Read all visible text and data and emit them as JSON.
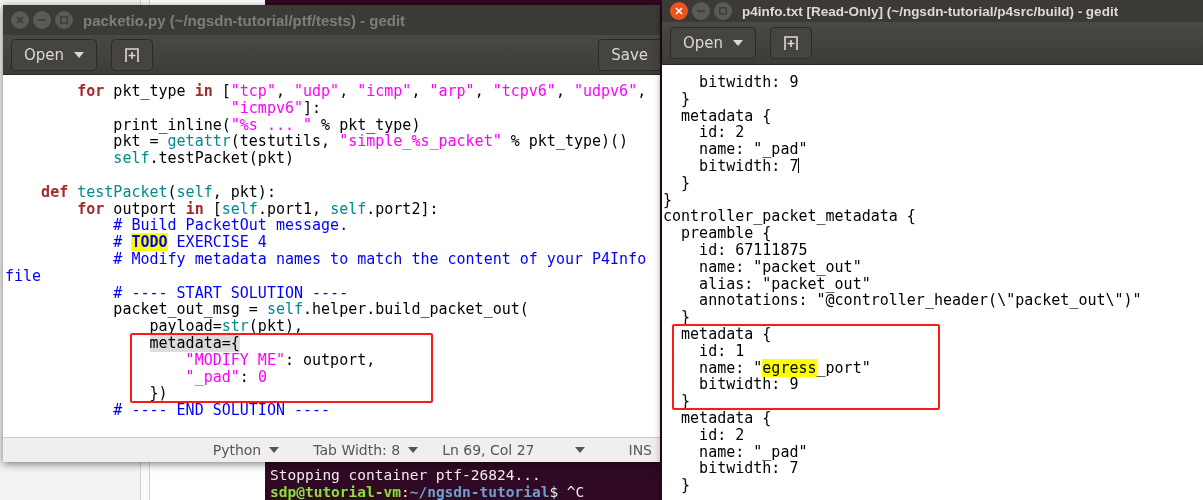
{
  "terminal": {
    "lines": [
      {
        "tokens": [
          {
            "kind": "plain",
            "text": "Stopping container ptf-26824..."
          }
        ]
      },
      {
        "tokens": [
          {
            "kind": "user",
            "text": "sdp@tutorial-vm"
          },
          {
            "kind": "plain",
            "text": ":"
          },
          {
            "kind": "path",
            "text": "~/ngsdn-tutorial"
          },
          {
            "kind": "plain",
            "text": "$ ^C"
          }
        ]
      }
    ]
  },
  "windows": [
    {
      "title": "packetio.py (~/ngsdn-tutorial/ptf/tests) - gedit",
      "focused": false,
      "toolbar": {
        "open_label": "Open",
        "save_label": "Save"
      },
      "editor": {
        "lines": [
          {
            "tokens": [
              {
                "kind": "keyword",
                "text": "        for"
              },
              {
                "kind": "plain",
                "text": " pkt_type "
              },
              {
                "kind": "keyword",
                "text": "in"
              },
              {
                "kind": "plain",
                "text": " ["
              },
              {
                "kind": "string",
                "text": "\"tcp\""
              },
              {
                "kind": "plain",
                "text": ", "
              },
              {
                "kind": "string",
                "text": "\"udp\""
              },
              {
                "kind": "plain",
                "text": ", "
              },
              {
                "kind": "string",
                "text": "\"icmp\""
              },
              {
                "kind": "plain",
                "text": ", "
              },
              {
                "kind": "string",
                "text": "\"arp\""
              },
              {
                "kind": "plain",
                "text": ", "
              },
              {
                "kind": "string",
                "text": "\"tcpv6\""
              },
              {
                "kind": "plain",
                "text": ", "
              },
              {
                "kind": "string",
                "text": "\"udpv6\""
              },
              {
                "kind": "plain",
                "text": ","
              }
            ]
          },
          {
            "tokens": [
              {
                "kind": "string",
                "text": "                         \"icmpv6\""
              },
              {
                "kind": "plain",
                "text": "]:"
              }
            ]
          },
          {
            "tokens": [
              {
                "kind": "plain",
                "text": "            print_inline("
              },
              {
                "kind": "string",
                "text": "\"%s ... \""
              },
              {
                "kind": "plain",
                "text": " % pkt_type)"
              }
            ]
          },
          {
            "tokens": [
              {
                "kind": "plain",
                "text": "            pkt = "
              },
              {
                "kind": "builtin",
                "text": "getattr"
              },
              {
                "kind": "plain",
                "text": "(testutils, "
              },
              {
                "kind": "string",
                "text": "\"simple_%s_packet\""
              },
              {
                "kind": "plain",
                "text": " % pkt_type)()"
              }
            ]
          },
          {
            "tokens": [
              {
                "kind": "builtin",
                "text": "            self"
              },
              {
                "kind": "plain",
                "text": ".testPacket(pkt)"
              }
            ]
          },
          {
            "kind": "blank"
          },
          {
            "tokens": [
              {
                "kind": "keyword",
                "text": "    def"
              },
              {
                "kind": "builtin",
                "text": " testPacket"
              },
              {
                "kind": "plain",
                "text": "("
              },
              {
                "kind": "builtin",
                "text": "self"
              },
              {
                "kind": "plain",
                "text": ", pkt):"
              }
            ]
          },
          {
            "tokens": [
              {
                "kind": "keyword",
                "text": "        for"
              },
              {
                "kind": "plain",
                "text": " outport "
              },
              {
                "kind": "keyword",
                "text": "in"
              },
              {
                "kind": "plain",
                "text": " ["
              },
              {
                "kind": "builtin",
                "text": "self"
              },
              {
                "kind": "plain",
                "text": ".port1, "
              },
              {
                "kind": "builtin",
                "text": "self"
              },
              {
                "kind": "plain",
                "text": ".port2]:"
              }
            ]
          },
          {
            "tokens": [
              {
                "kind": "comment",
                "text": "            # Build PacketOut message."
              }
            ]
          },
          {
            "tokens": [
              {
                "kind": "comment",
                "text": "            # "
              },
              {
                "kind": "todo",
                "text": "TODO"
              },
              {
                "kind": "comment",
                "text": " EXERCISE 4"
              }
            ]
          },
          {
            "tokens": [
              {
                "kind": "comment",
                "text": "            # Modify metadata names to match the content of your P4Info"
              }
            ]
          },
          {
            "tokens": [
              {
                "kind": "comment",
                "text": "file"
              }
            ]
          },
          {
            "tokens": [
              {
                "kind": "comment",
                "text": "            # ---- START SOLUTION ----"
              }
            ]
          },
          {
            "tokens": [
              {
                "kind": "plain",
                "text": "            packet_out_msg = "
              },
              {
                "kind": "builtin",
                "text": "self"
              },
              {
                "kind": "plain",
                "text": ".helper.build_packet_out("
              }
            ]
          },
          {
            "tokens": [
              {
                "kind": "plain",
                "text": "                payload="
              },
              {
                "kind": "builtin",
                "text": "str"
              },
              {
                "kind": "plain",
                "text": "(pkt),"
              }
            ]
          },
          {
            "tokens": [
              {
                "kind": "match",
                "text": "                metadata={"
              }
            ]
          },
          {
            "tokens": [
              {
                "kind": "string",
                "text": "                    \"MODIFY ME\""
              },
              {
                "kind": "plain",
                "text": ": outport,"
              }
            ]
          },
          {
            "tokens": [
              {
                "kind": "string",
                "text": "                    \"_pad\""
              },
              {
                "kind": "plain",
                "text": ": "
              },
              {
                "kind": "number",
                "text": "0"
              }
            ]
          },
          {
            "tokens": [
              {
                "kind": "plain",
                "text": "                })"
              }
            ]
          },
          {
            "tokens": [
              {
                "kind": "comment",
                "text": "            # ---- END SOLUTION ----"
              }
            ]
          }
        ]
      },
      "status_bar": {
        "language": "Python",
        "tab_width": "Tab Width: 8",
        "position": "Ln 69, Col 27",
        "mode": "INS"
      }
    },
    {
      "title": "p4info.txt [Read-Only] (~/ngsdn-tutorial/p4src/build) - gedit",
      "focused": true,
      "toolbar": {
        "open_label": "Open"
      },
      "editor": {
        "lines": [
          {
            "tokens": [
              {
                "kind": "plain",
                "text": "    bitwidth: 9"
              }
            ]
          },
          {
            "tokens": [
              {
                "kind": "plain",
                "text": "  }"
              }
            ]
          },
          {
            "tokens": [
              {
                "kind": "plain",
                "text": "  metadata {"
              }
            ]
          },
          {
            "tokens": [
              {
                "kind": "plain",
                "text": "    id: 2"
              }
            ]
          },
          {
            "tokens": [
              {
                "kind": "plain",
                "text": "    name: \"_pad\""
              }
            ]
          },
          {
            "tokens": [
              {
                "kind": "plain",
                "text": "    bitwidth: 7"
              },
              {
                "kind": "cursor"
              }
            ]
          },
          {
            "tokens": [
              {
                "kind": "plain",
                "text": "  }"
              }
            ]
          },
          {
            "tokens": [
              {
                "kind": "plain",
                "text": "}"
              }
            ]
          },
          {
            "tokens": [
              {
                "kind": "plain",
                "text": "controller_packet_metadata {"
              }
            ]
          },
          {
            "tokens": [
              {
                "kind": "plain",
                "text": "  preamble {"
              }
            ]
          },
          {
            "tokens": [
              {
                "kind": "plain",
                "text": "    id: 67111875"
              }
            ]
          },
          {
            "tokens": [
              {
                "kind": "plain",
                "text": "    name: \"packet_out\""
              }
            ]
          },
          {
            "tokens": [
              {
                "kind": "plain",
                "text": "    alias: \"packet_out\""
              }
            ]
          },
          {
            "tokens": [
              {
                "kind": "plain",
                "text": "    annotations: \"@controller_header(\\\"packet_out\\\")\""
              }
            ]
          },
          {
            "tokens": [
              {
                "kind": "plain",
                "text": "  }"
              }
            ]
          },
          {
            "tokens": [
              {
                "kind": "plain",
                "text": "  metadata {"
              }
            ]
          },
          {
            "tokens": [
              {
                "kind": "plain",
                "text": "    id: 1"
              }
            ]
          },
          {
            "tokens": [
              {
                "kind": "plain",
                "text": "    name: \""
              },
              {
                "kind": "search",
                "text": "egress"
              },
              {
                "kind": "plain",
                "text": "_port\""
              }
            ]
          },
          {
            "tokens": [
              {
                "kind": "plain",
                "text": "    bitwidth: 9"
              }
            ]
          },
          {
            "tokens": [
              {
                "kind": "plain",
                "text": "  }"
              }
            ]
          },
          {
            "tokens": [
              {
                "kind": "plain",
                "text": "  metadata {"
              }
            ]
          },
          {
            "tokens": [
              {
                "kind": "plain",
                "text": "    id: 2"
              }
            ]
          },
          {
            "tokens": [
              {
                "kind": "plain",
                "text": "    name: \"_pad\""
              }
            ]
          },
          {
            "tokens": [
              {
                "kind": "plain",
                "text": "    bitwidth: 7"
              }
            ]
          },
          {
            "tokens": [
              {
                "kind": "plain",
                "text": "  }"
              }
            ]
          }
        ]
      }
    }
  ]
}
